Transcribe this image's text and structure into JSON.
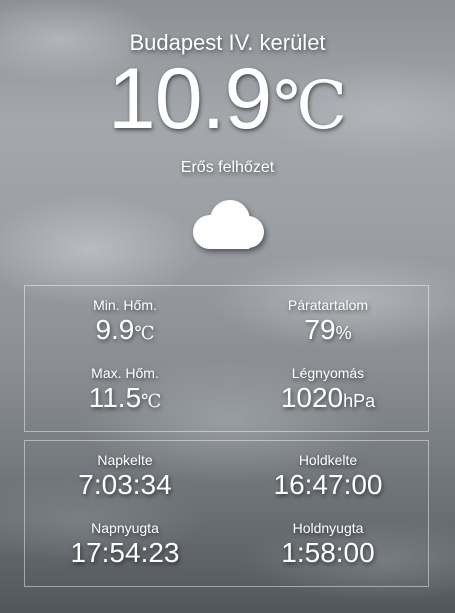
{
  "location": "Budapest IV. kerület",
  "temperature": {
    "value": "10.9",
    "unit": "℃"
  },
  "condition": "Erős felhőzet",
  "weather_icon": "cloud-icon",
  "stats": {
    "min_temp": {
      "label": "Min. Hőm.",
      "value": "9.9",
      "unit": "℃"
    },
    "humidity": {
      "label": "Páratartalom",
      "value": "79",
      "unit": "%"
    },
    "max_temp": {
      "label": "Max. Hőm.",
      "value": "11.5",
      "unit": "℃"
    },
    "pressure": {
      "label": "Légnyomás",
      "value": "1020",
      "unit": "hPa"
    }
  },
  "astro": {
    "sunrise": {
      "label": "Napkelte",
      "value": "7:03:34"
    },
    "moonrise": {
      "label": "Holdkelte",
      "value": "16:47:00"
    },
    "sunset": {
      "label": "Napnyugta",
      "value": "17:54:23"
    },
    "moonset": {
      "label": "Holdnyugta",
      "value": "1:58:00"
    }
  }
}
